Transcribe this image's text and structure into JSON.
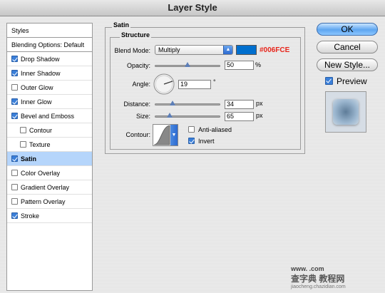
{
  "window": {
    "title": "Layer Style"
  },
  "sidebar": {
    "items": [
      {
        "label": "Styles",
        "checkbox": null,
        "header": true
      },
      {
        "label": "Blending Options: Default",
        "checkbox": null,
        "header": true
      },
      {
        "label": "Drop Shadow",
        "checkbox": true
      },
      {
        "label": "Inner Shadow",
        "checkbox": true
      },
      {
        "label": "Outer Glow",
        "checkbox": false
      },
      {
        "label": "Inner Glow",
        "checkbox": true
      },
      {
        "label": "Bevel and Emboss",
        "checkbox": true
      },
      {
        "label": "Contour",
        "checkbox": false,
        "indent": true
      },
      {
        "label": "Texture",
        "checkbox": false,
        "indent": true
      },
      {
        "label": "Satin",
        "checkbox": true,
        "selected": true
      },
      {
        "label": "Color Overlay",
        "checkbox": false
      },
      {
        "label": "Gradient Overlay",
        "checkbox": false
      },
      {
        "label": "Pattern Overlay",
        "checkbox": false
      },
      {
        "label": "Stroke",
        "checkbox": true
      }
    ]
  },
  "panel": {
    "title": "Satin",
    "structure_title": "Structure",
    "blend_mode_label": "Blend Mode:",
    "blend_mode_value": "Multiply",
    "color_swatch": "#006FCE",
    "color_annotation": "#006FCE",
    "opacity_label": "Opacity:",
    "opacity_value": "50",
    "opacity_unit": "%",
    "opacity_level": 0.5,
    "angle_label": "Angle:",
    "angle_value": "19",
    "angle_unit": "°",
    "distance_label": "Distance:",
    "distance_value": "34",
    "distance_unit": "px",
    "distance_level": 0.27,
    "size_label": "Size:",
    "size_value": "65",
    "size_unit": "px",
    "size_level": 0.23,
    "contour_label": "Contour:",
    "anti_aliased_label": "Anti-aliased",
    "anti_aliased_checked": false,
    "invert_label": "Invert",
    "invert_checked": true
  },
  "buttons": {
    "ok": "OK",
    "cancel": "Cancel",
    "new_style": "New Style...",
    "preview_label": "Preview",
    "preview_checked": true
  },
  "watermark": {
    "line1": "www. .com",
    "line2": "jiaocheng.chazidian.com",
    "brand": "查字典 教程网"
  }
}
